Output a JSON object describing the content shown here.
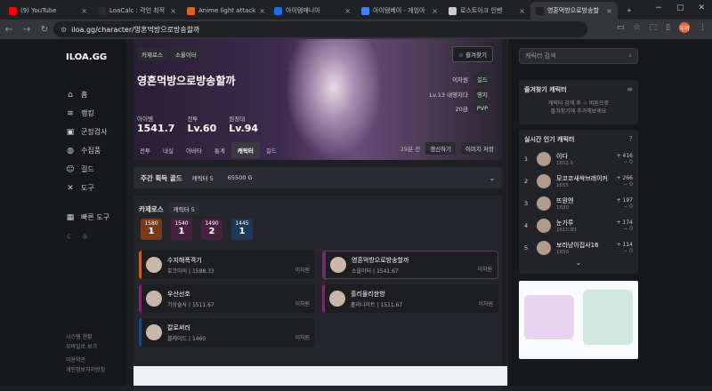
{
  "tabs": [
    {
      "label": "(9) YouTube",
      "color": "#ff0000"
    },
    {
      "label": "LoaCalc : 각인 최적",
      "color": "#2b2b2b"
    },
    {
      "label": "Anime light attack",
      "color": "#e06020"
    },
    {
      "label": "아이템매니아",
      "color": "#1f6feb"
    },
    {
      "label": "아이템베이 - 게임아",
      "color": "#3b82f6"
    },
    {
      "label": "로스트아크 인벤",
      "color": "#cccccc"
    },
    {
      "label": "영혼먹방으로방송할",
      "color": "#222222"
    }
  ],
  "url": "iloa.gg/character/영혼먹방으로방송할까",
  "profile_initial": "우비",
  "sidebar": {
    "logo": "ILOA.GG",
    "items": [
      {
        "icon": "⌂",
        "label": "홈"
      },
      {
        "icon": "≋",
        "label": "랭킹"
      },
      {
        "icon": "▣",
        "label": "군장검사"
      },
      {
        "icon": "◍",
        "label": "수집품"
      },
      {
        "icon": "☺",
        "label": "길드"
      },
      {
        "icon": "✕",
        "label": "도구"
      },
      {
        "icon": "▦",
        "label": "빠른 도구"
      }
    ],
    "footer": [
      "시스템 현황",
      "모바일로 보기",
      "이용약관",
      "개인정보처리방침"
    ]
  },
  "hero": {
    "chips": [
      "카제로스",
      "소울이터"
    ],
    "name": "영혼먹방으로방송할까",
    "stats": [
      {
        "label": "아이템",
        "value": "1541.7"
      },
      {
        "label": "전투",
        "value": "Lv.60"
      },
      {
        "label": "원정대",
        "value": "Lv.94"
      }
    ],
    "favorite": "☆ 즐겨찾기",
    "info": [
      {
        "label": "이차원",
        "tag": "길드"
      },
      {
        "label": "Lv.13 내영지다",
        "tag": "영지"
      },
      {
        "label": "20금",
        "tag": "PVP"
      }
    ],
    "tabs": [
      "전투",
      "내실",
      "아바타",
      "통계",
      "캐릭터",
      "길드"
    ],
    "active_tab": "캐릭터",
    "updated": "29분 전",
    "refresh": "갱신하기",
    "save_image": "이미지 저장"
  },
  "gold": {
    "title": "주간 획득 골드",
    "chars": "캐릭터 5",
    "amount": "65500 G"
  },
  "roster": {
    "server": "카제로스",
    "count": "캐릭터 5",
    "badges": [
      {
        "level": "1580",
        "n": "1",
        "color": "#7a3a1a"
      },
      {
        "level": "1540",
        "n": "1",
        "color": "#4a2040"
      },
      {
        "level": "1490",
        "n": "2",
        "color": "#4a2040"
      },
      {
        "level": "1445",
        "n": "1",
        "color": "#1a3a5a"
      }
    ],
    "chars": [
      {
        "name": "수지해폭격기",
        "cls": "호크아이",
        "lvl": "1588.33",
        "guild": "이차원",
        "bar": "#c06020"
      },
      {
        "name": "영혼먹방으로방송할까",
        "cls": "소울이터",
        "lvl": "1541.67",
        "guild": "이차원",
        "bar": "#7a2a6a"
      },
      {
        "name": "우산선호",
        "cls": "기상술사",
        "lvl": "1511.67",
        "guild": "이차원",
        "bar": "#7a2a6a"
      },
      {
        "name": "흘리몰리한방",
        "cls": "홀리나이트",
        "lvl": "1511.67",
        "guild": "이차원",
        "bar": "#7a2a6a"
      },
      {
        "name": "칼로써러",
        "cls": "블레이드",
        "lvl": "1460",
        "guild": "이차원",
        "bar": "#1a4a7a"
      }
    ]
  },
  "right": {
    "search_placeholder": "캐릭터 검색",
    "fav_title": "즐겨찾기 캐릭터",
    "fav_text1": "캐릭터 검색 후 ☆ 버튼으로",
    "fav_text2": "즐겨찾기에 추가해보세요",
    "hot_title": "실시간 인기 캐릭터",
    "ranks": [
      {
        "n": "1",
        "name": "이다",
        "score": "1652.5",
        "up": "+ 416",
        "down": "− 0"
      },
      {
        "n": "2",
        "name": "모코코새싹브레이커",
        "score": "1655",
        "up": "+ 266",
        "down": "− 0"
      },
      {
        "n": "3",
        "name": "뜨원엔",
        "score": "1630",
        "up": "+ 197",
        "down": "− 0"
      },
      {
        "n": "4",
        "name": "눈가루",
        "score": "1610.83",
        "up": "+ 174",
        "down": "− 0"
      },
      {
        "n": "5",
        "name": "보라냥이집사16",
        "score": "1650",
        "up": "+ 114",
        "down": "− 0"
      }
    ]
  }
}
